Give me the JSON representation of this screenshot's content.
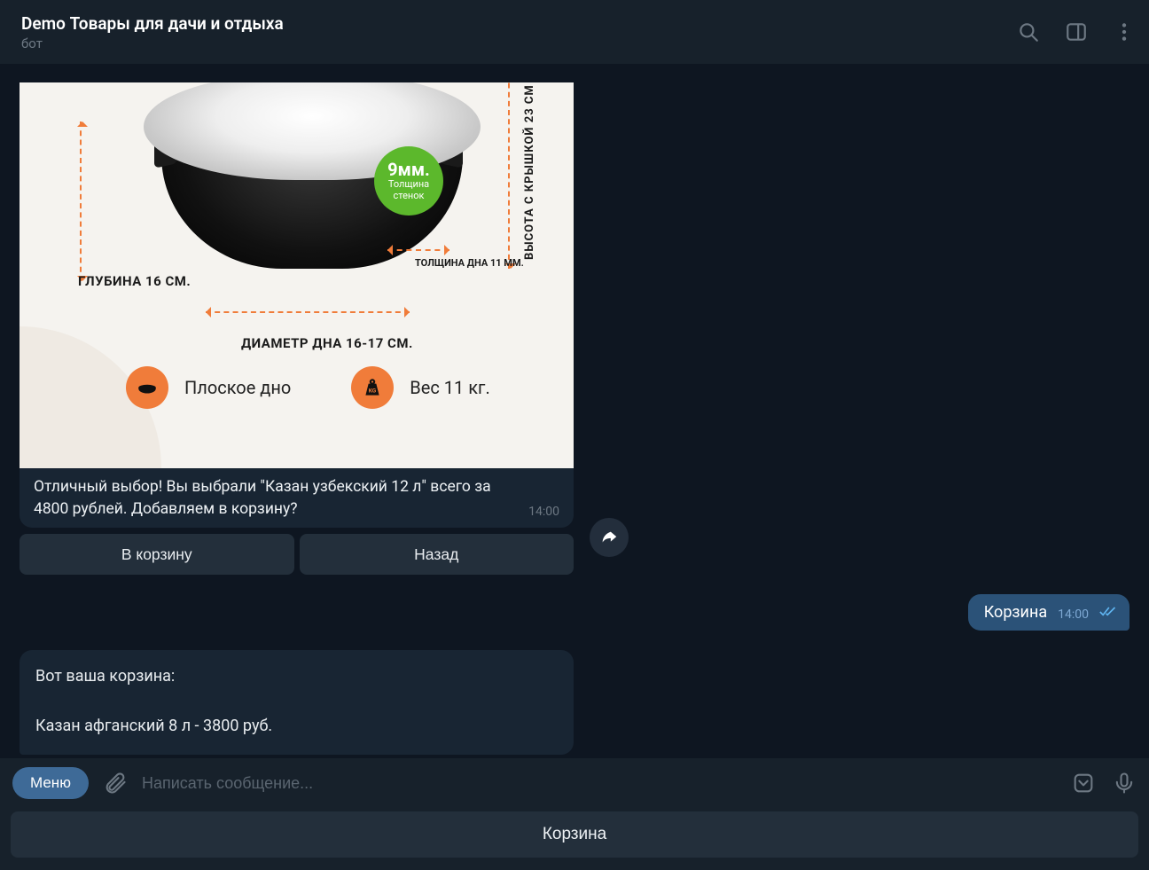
{
  "header": {
    "title": "Demo Товары для дачи и отдыха",
    "subtitle": "бот"
  },
  "product_image": {
    "badge_value": "9мм.",
    "badge_sub1": "Толщина",
    "badge_sub2": "стенок",
    "depth_label": "ГЛУБИНА 16 СМ.",
    "height_label": "ВЫСОТА С КРЫШКОЙ 23 СМ",
    "thickness_label": "ТОЛЩИНА ДНА\n11 ММ.",
    "diameter_label": "ДИАМЕТР ДНА 16-17 СМ.",
    "flat_bottom_label": "Плоское дно",
    "weight_label": "Вес 11 кг."
  },
  "bot_message_1": {
    "caption": "Отличный выбор! Вы выбрали \"Казан узбекский 12 л\" всего за 4800 рублей. Добавляем в корзину?",
    "time": "14:00",
    "buttons": {
      "add": "В корзину",
      "back": "Назад"
    }
  },
  "user_message": {
    "text": "Корзина",
    "time": "14:00"
  },
  "bot_message_2": {
    "text": "Вот ваша корзина:\n\nКазан афганский 8 л - 3800 руб."
  },
  "composer": {
    "menu_label": "Меню",
    "placeholder": "Написать сообщение..."
  },
  "reply_keyboard": {
    "button": "Корзина"
  }
}
